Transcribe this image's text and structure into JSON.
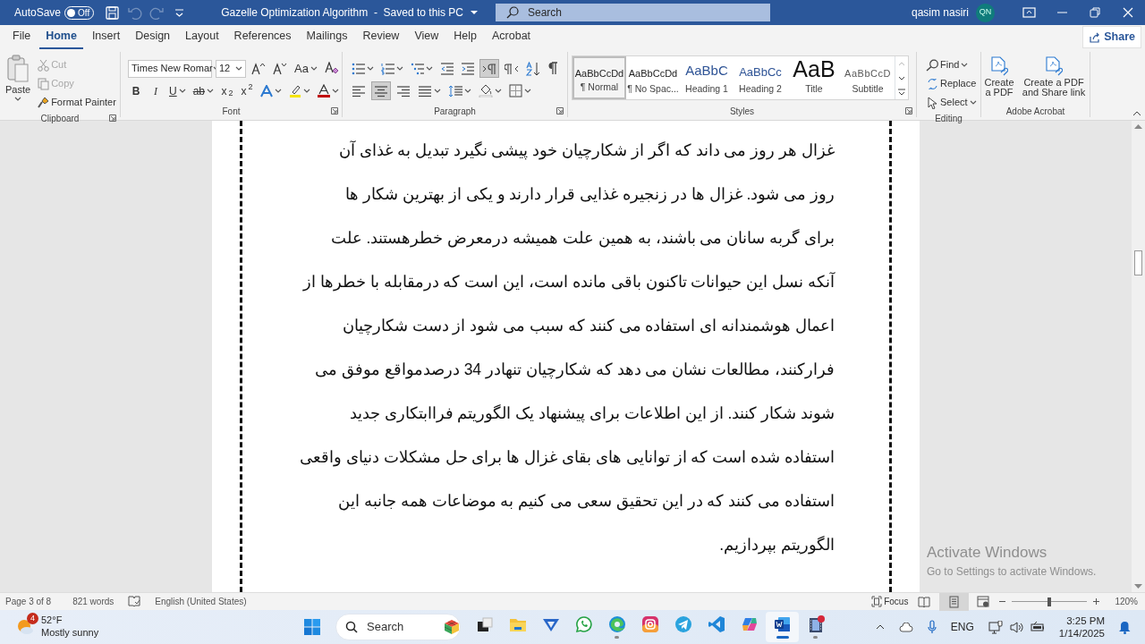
{
  "title_bar": {
    "autosave": {
      "label": "AutoSave",
      "on": false,
      "state_label": "Off"
    },
    "quick_access": [
      {
        "kind": "save",
        "disabled": false
      },
      {
        "kind": "undo",
        "disabled": true
      },
      {
        "kind": "redo",
        "disabled": true
      },
      {
        "kind": "customize",
        "disabled": false
      }
    ],
    "document_title": "Gazelle Optimization Algorithm  -  Saved to this PC",
    "search": {
      "placeholder": "Search"
    },
    "user_name": "qasim nasiri",
    "avatar_initials": "QN"
  },
  "menu_tabs": [
    {
      "label": "File",
      "selected": false
    },
    {
      "label": "Home",
      "selected": true
    },
    {
      "label": "Insert",
      "selected": false
    },
    {
      "label": "Design",
      "selected": false
    },
    {
      "label": "Layout",
      "selected": false
    },
    {
      "label": "References",
      "selected": false
    },
    {
      "label": "Mailings",
      "selected": false
    },
    {
      "label": "Review",
      "selected": false
    },
    {
      "label": "View",
      "selected": false
    },
    {
      "label": "Help",
      "selected": false
    },
    {
      "label": "Acrobat",
      "selected": false
    }
  ],
  "share": "Share",
  "ribbon": [
    {
      "kind": "clipboard",
      "label": "Clipboard",
      "paste": "Paste",
      "items": [
        {
          "kind": "cut",
          "label": "Cut",
          "disabled": true
        },
        {
          "kind": "copy",
          "label": "Copy",
          "disabled": true
        },
        {
          "kind": "format_painter",
          "label": "Format Painter",
          "disabled": false
        }
      ]
    },
    {
      "kind": "font",
      "label": "Font",
      "font_name": "Times New Romar",
      "font_size": "12",
      "case_button": "Aa",
      "format_buttons": [
        {
          "kind": "bold",
          "label": "B"
        },
        {
          "kind": "italic",
          "label": "I"
        },
        {
          "kind": "underline",
          "label": "U"
        },
        {
          "kind": "strike",
          "label": "ab"
        },
        {
          "kind": "subscript",
          "label": "x$_{2}$"
        },
        {
          "kind": "superscript",
          "label": "x$^{2}$"
        }
      ]
    },
    {
      "kind": "paragraph",
      "label": "Paragraph",
      "direction": [
        {
          "kind": "ltr",
          "selected": true
        },
        {
          "kind": "rtl",
          "selected": false
        }
      ],
      "alignment": [
        {
          "kind": "left",
          "selected": false
        },
        {
          "kind": "center",
          "selected": true
        },
        {
          "kind": "right",
          "selected": false
        },
        {
          "kind": "justify",
          "selected": false
        }
      ]
    },
    {
      "kind": "styles",
      "label": "Styles",
      "items": [
        {
          "kind": "normal",
          "sample": "AaBbCcDd",
          "label": "¶ Normal",
          "selected": true
        },
        {
          "kind": "no_spacing",
          "sample": "AaBbCcDd",
          "label": "¶ No Spac...",
          "selected": false
        },
        {
          "kind": "heading1",
          "sample": "AaBbC",
          "label": "Heading 1",
          "selected": false
        },
        {
          "kind": "heading2",
          "sample": "AaBbCc",
          "label": "Heading 2",
          "selected": false
        },
        {
          "kind": "title",
          "sample": "AaB",
          "label": "Title",
          "selected": false
        },
        {
          "kind": "subtitle",
          "sample": "AaBbCcD",
          "label": "Subtitle",
          "selected": false
        }
      ]
    },
    {
      "kind": "editing",
      "label": "Editing",
      "items": [
        {
          "kind": "find",
          "label": "Find"
        },
        {
          "kind": "replace",
          "label": "Replace"
        },
        {
          "kind": "select",
          "label": "Select"
        }
      ]
    },
    {
      "kind": "acrobat",
      "label": "Adobe Acrobat",
      "items": [
        {
          "kind": "create_pdf",
          "label": "Create a PDF"
        },
        {
          "kind": "share_pdf",
          "label": "Create a PDF and Share link"
        }
      ]
    }
  ],
  "document": {
    "lines": [
      "غزال هر روز می داند که اگر از شکارچیان خود پیشی نگیرد تبدیل به غذای آن",
      "روز می شود. غزال ها در زنجیره غذایی قرار دارند و یکی از بهترین شکار ها",
      "برای گربه سانان می باشند، به همین علت همیشه درمعرض خطرهستند. علت",
      "آنکه نسل این حیوانات تاکنون باقی مانده است، این است که درمقابله با خطرها از",
      "اعمال هوشمندانه ای استفاده می کنند که سبب می شود از دست شکارچیان",
      "فرارکنند، مطالعات نشان می دهد که شکارچیان تنهادر 34 درصدمواقع موفق می",
      "شوند شکار کنند. از این اطلاعات برای پیشنهاد یک الگوریتم فراابتکاری جدید",
      "استفاده شده است که از توانایی های بقای غزال ها برای حل مشکلات دنیای واقعی",
      "استفاده می کنند که در این تحقیق سعی می کنیم به موضاعات همه جانبه این",
      "الگوریتم بپردازیم."
    ]
  },
  "activation_notice": {
    "title": "Activate Windows",
    "subtitle": "Go to Settings to activate Windows."
  },
  "status_bar": {
    "page": "Page 3 of 8",
    "words": "821 words",
    "language": "English (United States)",
    "focus": "Focus",
    "views": [
      {
        "kind": "read",
        "selected": false
      },
      {
        "kind": "print",
        "selected": true
      },
      {
        "kind": "web",
        "selected": false
      }
    ],
    "zoom": {
      "level": 0.5,
      "reading": "120%"
    }
  },
  "taskbar": {
    "weather": {
      "badge": "4",
      "temperature": "52°F",
      "condition": "Mostly sunny"
    },
    "search": {
      "placeholder": "Search"
    },
    "apps": [
      {
        "kind": "windows",
        "running": false,
        "selected": false
      },
      {
        "kind": "folder",
        "running": false,
        "selected": false
      },
      {
        "kind": "vpn",
        "running": false,
        "selected": false
      },
      {
        "kind": "chat",
        "running": false,
        "selected": false
      },
      {
        "kind": "browser",
        "running": true,
        "selected": false
      },
      {
        "kind": "camera",
        "running": false,
        "selected": false
      },
      {
        "kind": "plane",
        "running": false,
        "selected": false
      },
      {
        "kind": "code",
        "running": false,
        "selected": false
      },
      {
        "kind": "petals",
        "running": false,
        "selected": false
      },
      {
        "kind": "word",
        "running": true,
        "selected": true
      },
      {
        "kind": "film",
        "running": true,
        "selected": false
      }
    ],
    "tray": {
      "language": "ENG",
      "time": "3:25 PM",
      "date": "1/14/2025"
    }
  }
}
